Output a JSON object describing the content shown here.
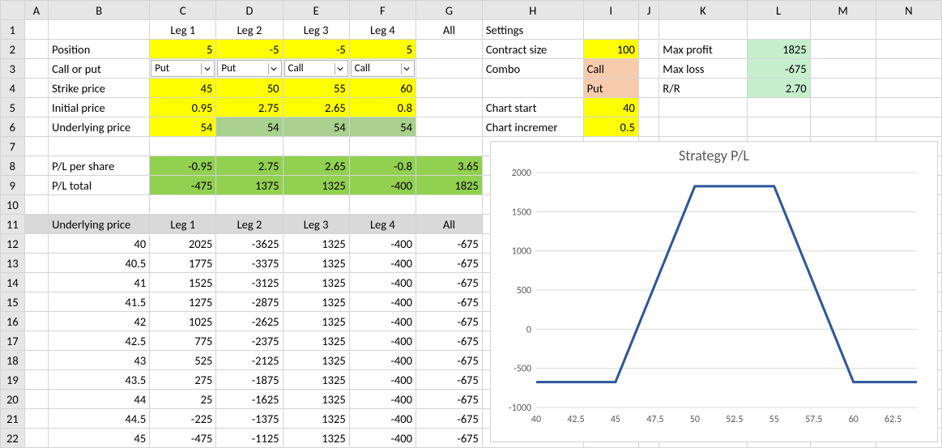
{
  "columns": [
    "A",
    "B",
    "C",
    "D",
    "E",
    "F",
    "G",
    "H",
    "I",
    "J",
    "K",
    "L",
    "M",
    "N"
  ],
  "row_numbers": [
    1,
    2,
    3,
    4,
    5,
    6,
    7,
    8,
    9,
    10,
    11,
    12,
    13,
    14,
    15,
    16,
    17,
    18,
    19,
    20,
    21,
    22
  ],
  "labels": {
    "leg1": "Leg 1",
    "leg2": "Leg 2",
    "leg3": "Leg 3",
    "leg4": "Leg 4",
    "all": "All",
    "settings": "Settings",
    "position": "Position",
    "call_or_put": "Call or put",
    "strike": "Strike price",
    "initial": "Initial price",
    "underlying": "Underlying price",
    "pl_share": "P/L per share",
    "pl_total": "P/L total",
    "contract_size": "Contract size",
    "combo": "Combo",
    "chart_start": "Chart start",
    "chart_incr": "Chart incremer",
    "max_profit": "Max profit",
    "max_loss": "Max loss",
    "rr": "R/R"
  },
  "vals": {
    "pos": [
      "5",
      "-5",
      "-5",
      "5"
    ],
    "cp": [
      "Put",
      "Put",
      "Call",
      "Call"
    ],
    "strike": [
      "45",
      "50",
      "55",
      "60"
    ],
    "init": [
      "0.95",
      "2.75",
      "2.65",
      "0.8"
    ],
    "under": [
      "54",
      "54",
      "54",
      "54"
    ],
    "pl_share": [
      "-0.95",
      "2.75",
      "2.65",
      "-0.8",
      "3.65"
    ],
    "pl_total": [
      "-475",
      "1375",
      "1325",
      "-400",
      "1825"
    ],
    "contract_size": "100",
    "combo": [
      "Call",
      "Put"
    ],
    "chart_start": "40",
    "chart_incr": "0.5",
    "max_profit": "1825",
    "max_loss": "-675",
    "rr": "2.70"
  },
  "table_hdr": [
    "Underlying price",
    "Leg 1",
    "Leg 2",
    "Leg 3",
    "Leg 4",
    "All"
  ],
  "table_rows": [
    [
      "40",
      "2025",
      "-3625",
      "1325",
      "-400",
      "-675"
    ],
    [
      "40.5",
      "1775",
      "-3375",
      "1325",
      "-400",
      "-675"
    ],
    [
      "41",
      "1525",
      "-3125",
      "1325",
      "-400",
      "-675"
    ],
    [
      "41.5",
      "1275",
      "-2875",
      "1325",
      "-400",
      "-675"
    ],
    [
      "42",
      "1025",
      "-2625",
      "1325",
      "-400",
      "-675"
    ],
    [
      "42.5",
      "775",
      "-2375",
      "1325",
      "-400",
      "-675"
    ],
    [
      "43",
      "525",
      "-2125",
      "1325",
      "-400",
      "-675"
    ],
    [
      "43.5",
      "275",
      "-1875",
      "1325",
      "-400",
      "-675"
    ],
    [
      "44",
      "25",
      "-1625",
      "1325",
      "-400",
      "-675"
    ],
    [
      "44.5",
      "-225",
      "-1375",
      "1325",
      "-400",
      "-675"
    ],
    [
      "45",
      "-475",
      "-1125",
      "1325",
      "-400",
      "-675"
    ]
  ],
  "chart_data": {
    "type": "line",
    "title": "Strategy P/L",
    "xlabel": "",
    "ylabel": "",
    "ylim": [
      -1000,
      2000
    ],
    "x_ticks": [
      "40",
      "42.5",
      "45",
      "47.5",
      "50",
      "52.5",
      "55",
      "57.5",
      "60",
      "62.5"
    ],
    "y_ticks": [
      "2000",
      "1500",
      "1000",
      "500",
      "0",
      "-500",
      "-1000"
    ],
    "series": [
      {
        "name": "All",
        "x": [
          40,
          40.5,
          41,
          41.5,
          42,
          42.5,
          43,
          43.5,
          44,
          44.5,
          45,
          45.5,
          46,
          46.5,
          47,
          47.5,
          48,
          48.5,
          49,
          49.5,
          50,
          50.5,
          51,
          51.5,
          52,
          52.5,
          53,
          53.5,
          54,
          54.5,
          55,
          55.5,
          56,
          56.5,
          57,
          57.5,
          58,
          58.5,
          59,
          59.5,
          60,
          60.5,
          61,
          61.5,
          62,
          62.5,
          63,
          63.5,
          64
        ],
        "y": [
          -675,
          -675,
          -675,
          -675,
          -675,
          -675,
          -675,
          -675,
          -675,
          -675,
          -675,
          -425,
          -175,
          75,
          325,
          575,
          825,
          1075,
          1325,
          1575,
          1825,
          1825,
          1825,
          1825,
          1825,
          1825,
          1825,
          1825,
          1825,
          1825,
          1825,
          1575,
          1325,
          1075,
          825,
          575,
          325,
          75,
          -175,
          -425,
          -675,
          -675,
          -675,
          -675,
          -675,
          -675,
          -675,
          -675,
          -675
        ]
      }
    ]
  }
}
